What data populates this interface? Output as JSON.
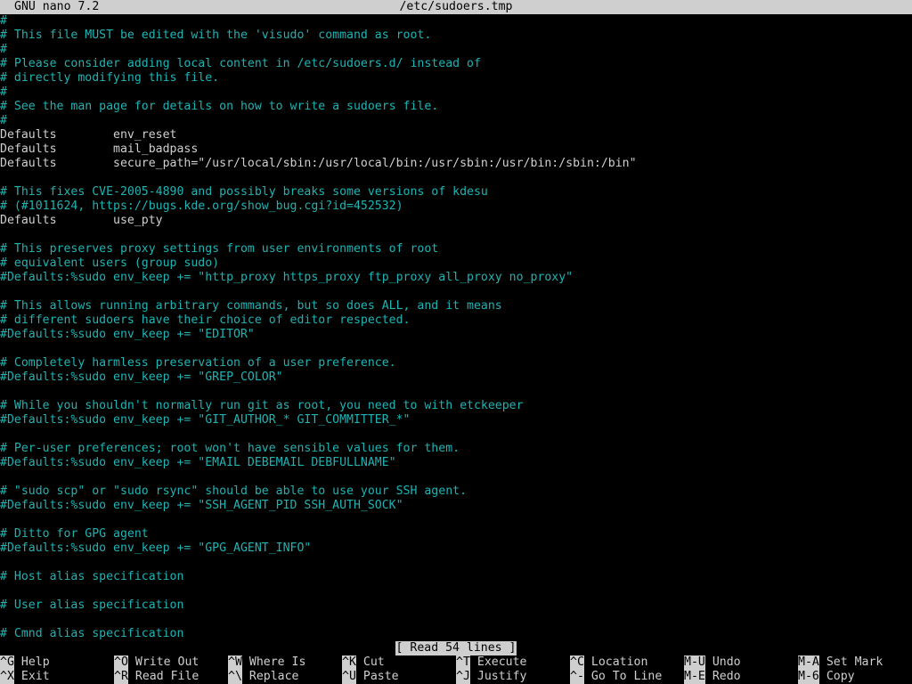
{
  "titlebar": {
    "app": "GNU nano 7.2",
    "filename": "/etc/sudoers.tmp"
  },
  "buffer": {
    "lines": [
      {
        "text": "#",
        "type": "comment"
      },
      {
        "text": "# This file MUST be edited with the 'visudo' command as root.",
        "type": "comment"
      },
      {
        "text": "#",
        "type": "comment"
      },
      {
        "text": "# Please consider adding local content in /etc/sudoers.d/ instead of",
        "type": "comment"
      },
      {
        "text": "# directly modifying this file.",
        "type": "comment"
      },
      {
        "text": "#",
        "type": "comment"
      },
      {
        "text": "# See the man page for details on how to write a sudoers file.",
        "type": "comment"
      },
      {
        "text": "#",
        "type": "comment"
      },
      {
        "text": "Defaults        env_reset",
        "type": "directive"
      },
      {
        "text": "Defaults        mail_badpass",
        "type": "directive"
      },
      {
        "text": "Defaults        secure_path=\"/usr/local/sbin:/usr/local/bin:/usr/sbin:/usr/bin:/sbin:/bin\"",
        "type": "directive"
      },
      {
        "text": "",
        "type": "directive"
      },
      {
        "text": "# This fixes CVE-2005-4890 and possibly breaks some versions of kdesu",
        "type": "comment"
      },
      {
        "text": "# (#1011624, https://bugs.kde.org/show_bug.cgi?id=452532)",
        "type": "comment"
      },
      {
        "text": "Defaults        use_pty",
        "type": "directive"
      },
      {
        "text": "",
        "type": "directive"
      },
      {
        "text": "# This preserves proxy settings from user environments of root",
        "type": "comment"
      },
      {
        "text": "# equivalent users (group sudo)",
        "type": "comment"
      },
      {
        "text": "#Defaults:%sudo env_keep += \"http_proxy https_proxy ftp_proxy all_proxy no_proxy\"",
        "type": "comment"
      },
      {
        "text": "",
        "type": "directive"
      },
      {
        "text": "# This allows running arbitrary commands, but so does ALL, and it means",
        "type": "comment"
      },
      {
        "text": "# different sudoers have their choice of editor respected.",
        "type": "comment"
      },
      {
        "text": "#Defaults:%sudo env_keep += \"EDITOR\"",
        "type": "comment"
      },
      {
        "text": "",
        "type": "directive"
      },
      {
        "text": "# Completely harmless preservation of a user preference.",
        "type": "comment"
      },
      {
        "text": "#Defaults:%sudo env_keep += \"GREP_COLOR\"",
        "type": "comment"
      },
      {
        "text": "",
        "type": "directive"
      },
      {
        "text": "# While you shouldn't normally run git as root, you need to with etckeeper",
        "type": "comment"
      },
      {
        "text": "#Defaults:%sudo env_keep += \"GIT_AUTHOR_* GIT_COMMITTER_*\"",
        "type": "comment"
      },
      {
        "text": "",
        "type": "directive"
      },
      {
        "text": "# Per-user preferences; root won't have sensible values for them.",
        "type": "comment"
      },
      {
        "text": "#Defaults:%sudo env_keep += \"EMAIL DEBEMAIL DEBFULLNAME\"",
        "type": "comment"
      },
      {
        "text": "",
        "type": "directive"
      },
      {
        "text": "# \"sudo scp\" or \"sudo rsync\" should be able to use your SSH agent.",
        "type": "comment"
      },
      {
        "text": "#Defaults:%sudo env_keep += \"SSH_AGENT_PID SSH_AUTH_SOCK\"",
        "type": "comment"
      },
      {
        "text": "",
        "type": "directive"
      },
      {
        "text": "# Ditto for GPG agent",
        "type": "comment"
      },
      {
        "text": "#Defaults:%sudo env_keep += \"GPG_AGENT_INFO\"",
        "type": "comment"
      },
      {
        "text": "",
        "type": "directive"
      },
      {
        "text": "# Host alias specification",
        "type": "comment"
      },
      {
        "text": "",
        "type": "directive"
      },
      {
        "text": "# User alias specification",
        "type": "comment"
      },
      {
        "text": "",
        "type": "directive"
      },
      {
        "text": "# Cmnd alias specification",
        "type": "comment"
      }
    ]
  },
  "status": {
    "message": "[ Read 54 lines ]"
  },
  "shortcuts": [
    [
      {
        "key": "^G",
        "label": "Help"
      },
      {
        "key": "^O",
        "label": "Write Out"
      },
      {
        "key": "^W",
        "label": "Where Is"
      },
      {
        "key": "^K",
        "label": "Cut"
      },
      {
        "key": "^T",
        "label": "Execute"
      },
      {
        "key": "^C",
        "label": "Location"
      },
      {
        "key": "M-U",
        "label": "Undo"
      },
      {
        "key": "M-A",
        "label": "Set Mark"
      }
    ],
    [
      {
        "key": "^X",
        "label": "Exit"
      },
      {
        "key": "^R",
        "label": "Read File"
      },
      {
        "key": "^\\",
        "label": "Replace"
      },
      {
        "key": "^U",
        "label": "Paste"
      },
      {
        "key": "^J",
        "label": "Justify"
      },
      {
        "key": "^-",
        "label": "Go To Line"
      },
      {
        "key": "M-E",
        "label": "Redo"
      },
      {
        "key": "M-6",
        "label": "Copy"
      }
    ]
  ],
  "colors": {
    "comment": "#1fb3b3",
    "text": "#cfcfcf",
    "inverse_bg": "#cfcfcf",
    "background": "#000000"
  }
}
